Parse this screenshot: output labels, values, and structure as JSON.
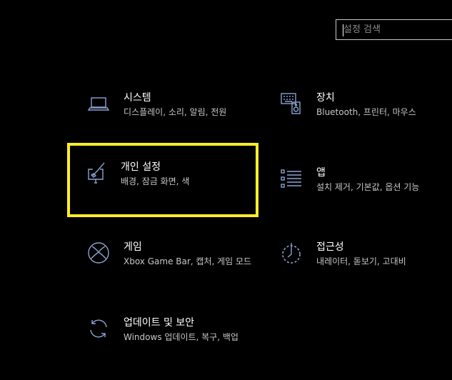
{
  "search": {
    "placeholder": "설정 검색"
  },
  "colors": {
    "background": "#000000",
    "icon_stroke": "#8ba3cf",
    "focus_outline": "#ffef28",
    "title_text": "#ffffff",
    "desc_text": "#c7c7c7"
  },
  "tiles": [
    {
      "title": "시스템",
      "desc": "디스플레이, 소리, 알림, 전원",
      "icon": "laptop-icon"
    },
    {
      "title": "장치",
      "desc": "Bluetooth, 프린터, 마우스",
      "icon": "keyboard-speaker-icon"
    },
    {
      "title": "개인 설정",
      "desc": "배경, 잠금 화면, 색",
      "icon": "paintbrush-monitor-icon",
      "focused": true
    },
    {
      "title": "앱",
      "desc": "설치 제거, 기본값, 옵션 기능",
      "icon": "app-list-icon"
    },
    {
      "title": "게임",
      "desc": "Xbox Game Bar, 캡처, 게임 모드",
      "icon": "xbox-icon"
    },
    {
      "title": "접근성",
      "desc": "내레이터, 돋보기, 고대비",
      "icon": "accessibility-timer-icon"
    },
    {
      "title": "업데이트 및 보안",
      "desc": "Windows 업데이트, 복구, 백업",
      "icon": "sync-icon"
    }
  ]
}
